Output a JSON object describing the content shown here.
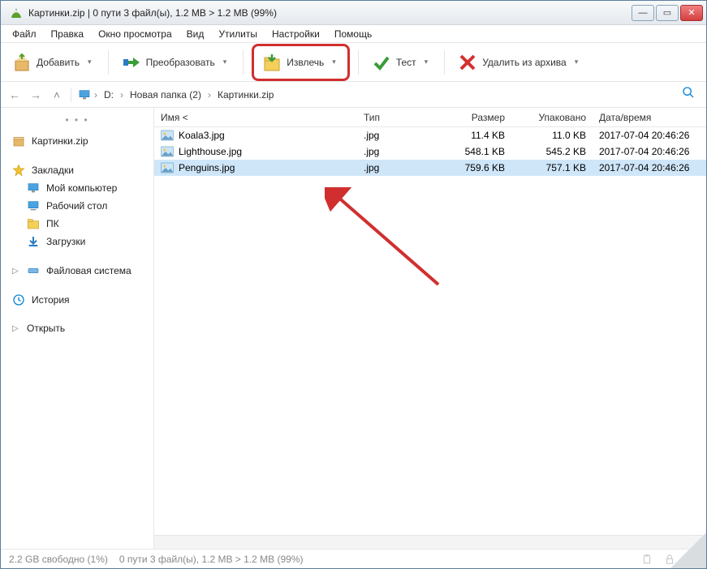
{
  "title": "Картинки.zip | 0 пути 3 файл(ы), 1.2 MB > 1.2 MB (99%)",
  "menu": {
    "file": "Файл",
    "edit": "Правка",
    "view_window": "Окно просмотра",
    "view": "Вид",
    "utils": "Утилиты",
    "settings": "Настройки",
    "help": "Помощь"
  },
  "toolbar": {
    "add": "Добавить",
    "convert": "Преобразовать",
    "extract": "Извлечь",
    "test": "Тест",
    "delete": "Удалить из архива"
  },
  "breadcrumb": {
    "d": "D:",
    "folder": "Новая папка (2)",
    "archive": "Картинки.zip"
  },
  "columns": {
    "name": "Имя <",
    "type": "Тип",
    "size": "Размер",
    "packed": "Упаковано",
    "date": "Дата/время"
  },
  "files": [
    {
      "name": "Koala3.jpg",
      "type": ".jpg",
      "size": "11.4 KB",
      "packed": "11.0 KB",
      "date": "2017-07-04 20:46:26"
    },
    {
      "name": "Lighthouse.jpg",
      "type": ".jpg",
      "size": "548.1 KB",
      "packed": "545.2 KB",
      "date": "2017-07-04 20:46:26"
    },
    {
      "name": "Penguins.jpg",
      "type": ".jpg",
      "size": "759.6 KB",
      "packed": "757.1 KB",
      "date": "2017-07-04 20:46:26"
    }
  ],
  "sidebar": {
    "archive": "Картинки.zip",
    "bookmarks": "Закладки",
    "my_computer": "Мой компьютер",
    "desktop": "Рабочий стол",
    "pc": "ПК",
    "downloads": "Загрузки",
    "filesystem": "Файловая система",
    "history": "История",
    "open": "Открыть"
  },
  "status": {
    "free": "2.2 GB свободно (1%)",
    "sel": "0 пути 3 файл(ы), 1.2 MB > 1.2 MB (99%)"
  }
}
